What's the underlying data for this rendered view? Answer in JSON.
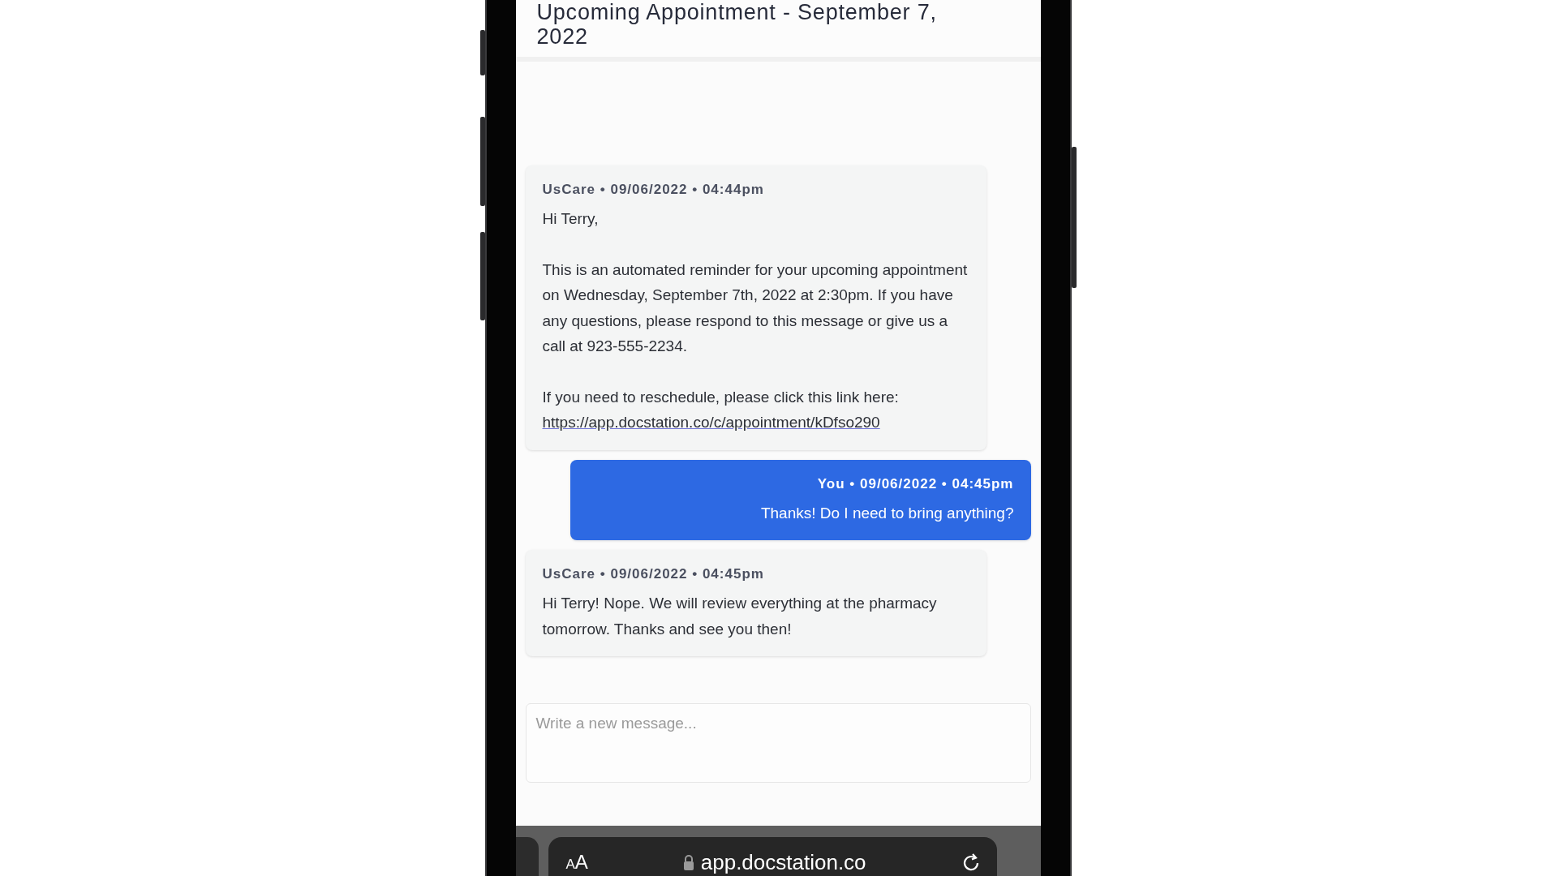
{
  "header": {
    "title": "Upcoming Appointment - September 7, 2022"
  },
  "messages": [
    {
      "meta": "UsCare • 09/06/2022 • 04:44pm",
      "outgoing": false,
      "paragraphs": [
        "Hi Terry,",
        "This is an automated reminder for your upcoming appointment on Wednesday, September 7th, 2022 at 2:30pm. If you have any questions, please respond to this message or give us a call at 923-555-2234.",
        "If you need to reschedule, please click this link here:"
      ],
      "link": "https://app.docstation.co/c/appointment/kDfso290"
    },
    {
      "meta": "You • 09/06/2022 • 04:45pm",
      "outgoing": true,
      "paragraphs": [
        "Thanks! Do I need to bring anything?"
      ]
    },
    {
      "meta": "UsCare • 09/06/2022 • 04:45pm",
      "outgoing": false,
      "paragraphs": [
        "Hi Terry! Nope. We will review everything at the pharmacy tomorrow. Thanks and see you then!"
      ]
    }
  ],
  "composer": {
    "placeholder": "Write a new message..."
  },
  "browser_bar": {
    "text_size": "AA",
    "url": "app.docstation.co"
  }
}
